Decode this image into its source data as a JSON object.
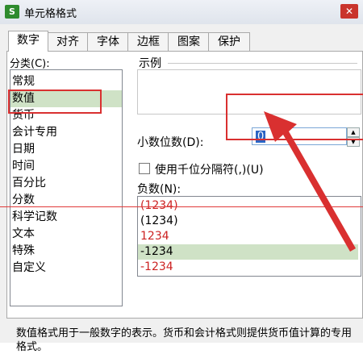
{
  "window": {
    "title": "单元格格式",
    "close_glyph": "✕",
    "app_icon_glyph": "S"
  },
  "tabs": [
    {
      "label": "数字"
    },
    {
      "label": "对齐"
    },
    {
      "label": "字体"
    },
    {
      "label": "边框"
    },
    {
      "label": "图案"
    },
    {
      "label": "保护"
    }
  ],
  "category": {
    "label": "分类(C):",
    "items": [
      "常规",
      "数值",
      "货币",
      "会计专用",
      "日期",
      "时间",
      "百分比",
      "分数",
      "科学记数",
      "文本",
      "特殊",
      "自定义"
    ],
    "selected": "数值"
  },
  "sample": {
    "label": "示例"
  },
  "decimal": {
    "label": "小数位数(D):",
    "value": "0"
  },
  "thousands": {
    "label": "使用千位分隔符(,)(U)"
  },
  "negative": {
    "label": "负数(N):",
    "items": [
      {
        "text": "(1234)",
        "color": "#cc2222"
      },
      {
        "text": "(1234)",
        "color": "#000000"
      },
      {
        "text": "1234",
        "color": "#cc2222"
      },
      {
        "text": "-1234",
        "color": "#000000",
        "selected": true
      },
      {
        "text": "-1234",
        "color": "#cc2222"
      }
    ]
  },
  "description": "数值格式用于一般数字的表示。货币和会计格式则提供货币值计算的专用格式。",
  "colors": {
    "annotation": "#d93030",
    "selection": "#cfe2c6"
  }
}
